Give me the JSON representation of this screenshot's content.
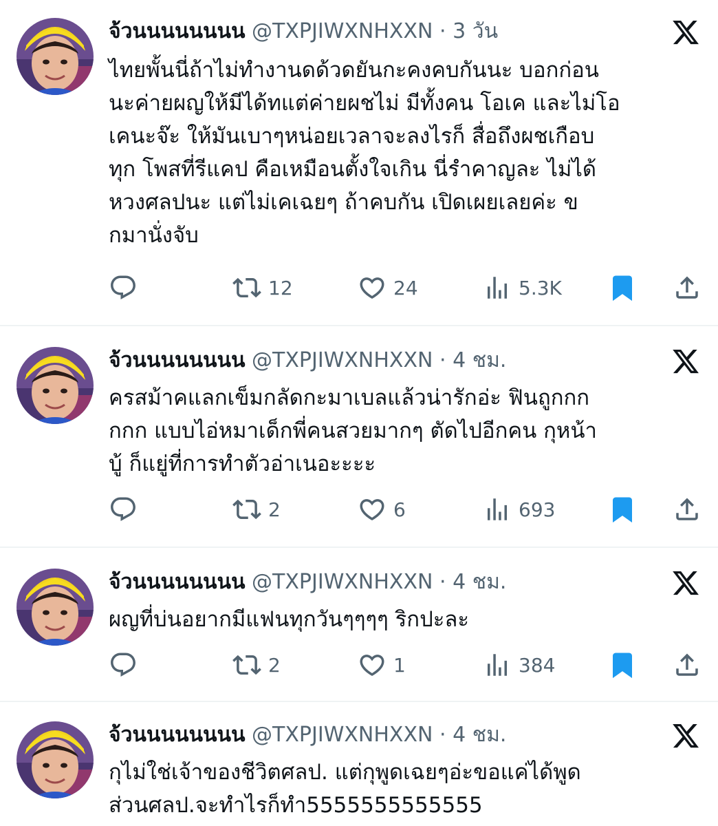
{
  "colors": {
    "text": "#0f1419",
    "secondary": "#536471",
    "bookmark": "#1d9bf0",
    "divider": "#eff3f4"
  },
  "icons": {
    "reply": "reply-icon",
    "retweet": "retweet-icon",
    "like": "heart-icon",
    "views": "views-icon",
    "bookmark": "bookmark-filled-icon",
    "share": "share-icon",
    "logo": "x-logo-icon"
  },
  "tweets": [
    {
      "name": "จ้วนนนนนนนน",
      "handle": "@TXPJIWXNHXXN",
      "sep": "·",
      "time": "3 วัน",
      "text": "ไทยพั้นนี่ถ้าไม่ทำงานดด้วดยันกะคงคบกันนะ บอกก่อน\nนะค่ายผญให้มีได้ทแต่ค่ายผชไม่ มีทั้งคน โอเค และไม่โอ\nเคนะจ๊ะ ให้มันเบาๆหน่อยเวลาจะลงไรก็ สื่อถึงผชเกือบ\nทุก โพสที่รีแคป คือเหมือนตั้งใจเกิน นี่รำคาญละ ไม่ได้\nหวงศลปนะ แต่ไม่เคเฉยๆ ถ้าคบกัน เปิดเผยเลยค่ะ ข\nกมานั่งจับ",
      "retweets": "12",
      "likes": "24",
      "views": "5.3K"
    },
    {
      "name": "จ้วนนนนนนนน",
      "handle": "@TXPJIWXNHXXN",
      "sep": "·",
      "time": "4 ชม.",
      "text": "ครสม้าคแลกเข็มกลัดกะมาเบลแล้วน่ารักอ่ะ ฟินถูกกก\nกกก แบบไอ่หมาเด็กพี่คนสวยมากๆ ตัดไปอีกคน กุหน้า\nบู้ ก็แยู่ที่การทำตัวอ่าเนอะะะะ",
      "retweets": "2",
      "likes": "6",
      "views": "693"
    },
    {
      "name": "จ้วนนนนนนนน",
      "handle": "@TXPJIWXNHXXN",
      "sep": "·",
      "time": "4 ชม.",
      "text": "ผญที่บ่นอยากมีแฟนทุกวันๆๆๆๆ ริกปะละ",
      "retweets": "2",
      "likes": "1",
      "views": "384"
    },
    {
      "name": "จ้วนนนนนนนน",
      "handle": "@TXPJIWXNHXXN",
      "sep": "·",
      "time": "4 ชม.",
      "text": "กุไม่ใช่เจ้าของชีวิตศลป. แต่กุพูดเฉยๆอ่ะขอแค่ได้พูด\nส่วนศลป.จะทำไรก็ทำ5555555555555",
      "retweets": "",
      "likes": "",
      "views": ""
    }
  ]
}
